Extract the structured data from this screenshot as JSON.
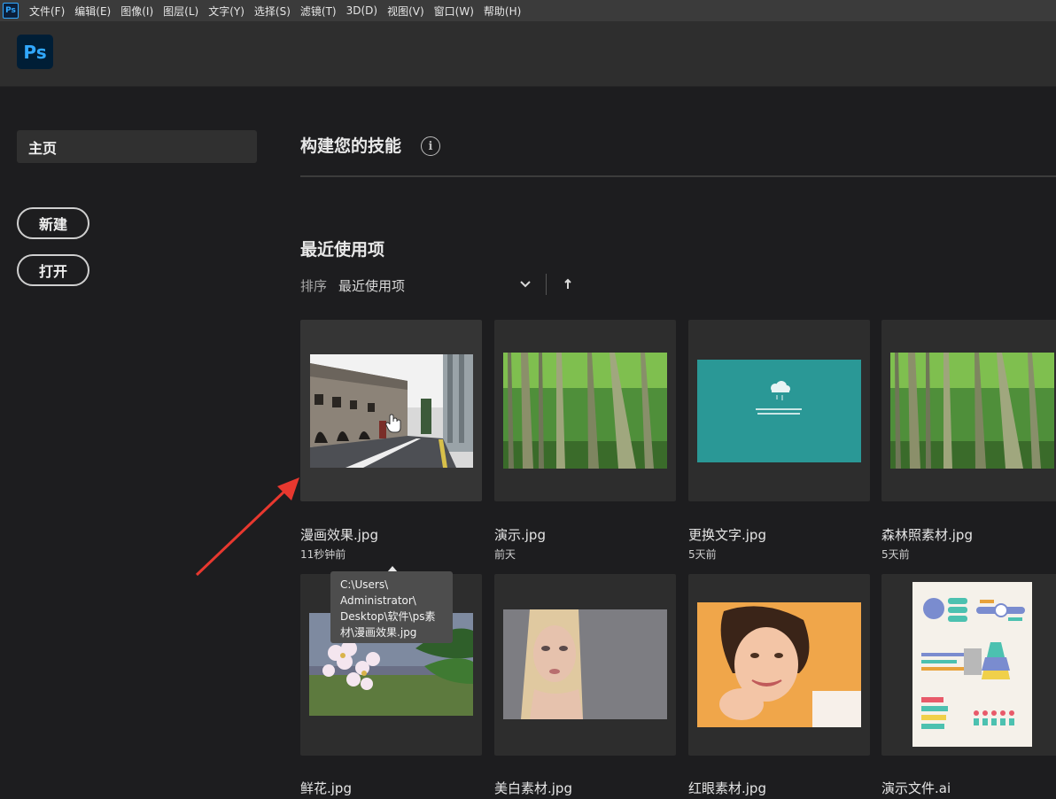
{
  "menubar": {
    "app_icon": "Ps",
    "items": [
      "文件(F)",
      "编辑(E)",
      "图像(I)",
      "图层(L)",
      "文字(Y)",
      "选择(S)",
      "滤镜(T)",
      "3D(D)",
      "视图(V)",
      "窗口(W)",
      "帮助(H)"
    ]
  },
  "header": {
    "logo": "Ps"
  },
  "sidebar": {
    "home": "主页",
    "new_button": "新建",
    "open_button": "打开"
  },
  "main": {
    "skills_title": "构建您的技能",
    "info_icon": "i",
    "recent_title": "最近使用项",
    "sort_label": "排序",
    "sort_value": "最近使用项"
  },
  "recent_files": [
    {
      "name": "漫画效果.jpg",
      "time": "11秒钟前"
    },
    {
      "name": "演示.jpg",
      "time": "前天"
    },
    {
      "name": "更换文字.jpg",
      "time": "5天前"
    },
    {
      "name": "森林照素材.jpg",
      "time": "5天前"
    },
    {
      "name": "鲜花.jpg",
      "time": ""
    },
    {
      "name": "美白素材.jpg",
      "time": ""
    },
    {
      "name": "红眼素材.jpg",
      "time": ""
    },
    {
      "name": "演示文件.ai",
      "time": ""
    }
  ],
  "tooltip": {
    "lines": [
      "C:\\Users\\",
      "Administrator\\",
      "Desktop\\软件\\ps素",
      "材\\漫画效果.jpg"
    ]
  },
  "colors": {
    "menubar_bg": "#3b3b3b",
    "header_bg": "#2e2e2e",
    "body_bg": "#1d1d1f",
    "ps_blue": "#31a8ff",
    "annotation_red": "#e8382f"
  }
}
